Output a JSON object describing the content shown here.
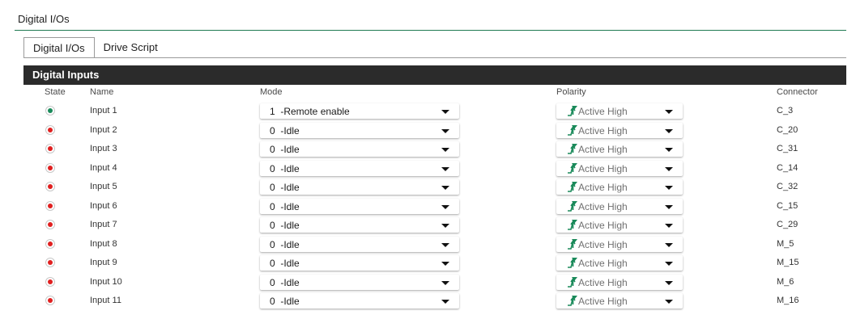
{
  "panel": {
    "title": "Digital I/Os"
  },
  "tabs": [
    {
      "label": "Digital I/Os",
      "active": true
    },
    {
      "label": "Drive Script",
      "active": false
    }
  ],
  "section": {
    "title": "Digital Inputs"
  },
  "columns": {
    "state": "State",
    "name": "Name",
    "mode": "Mode",
    "polarity": "Polarity",
    "connector": "Connector"
  },
  "colors": {
    "state_active": "#1a8a5a",
    "state_inactive": "#e02020",
    "polarity_icon": "#1a8a5a",
    "accent_rule": "#1f7a52"
  },
  "inputs": [
    {
      "state": "active",
      "name": "Input 1",
      "mode": "1  -Remote enable",
      "polarity": "Active High",
      "connector": "C_3"
    },
    {
      "state": "inactive",
      "name": "Input 2",
      "mode": "0  -Idle",
      "polarity": "Active High",
      "connector": "C_20"
    },
    {
      "state": "inactive",
      "name": "Input 3",
      "mode": "0  -Idle",
      "polarity": "Active High",
      "connector": "C_31"
    },
    {
      "state": "inactive",
      "name": "Input 4",
      "mode": "0  -Idle",
      "polarity": "Active High",
      "connector": "C_14"
    },
    {
      "state": "inactive",
      "name": "Input 5",
      "mode": "0  -Idle",
      "polarity": "Active High",
      "connector": "C_32"
    },
    {
      "state": "inactive",
      "name": "Input 6",
      "mode": "0  -Idle",
      "polarity": "Active High",
      "connector": "C_15"
    },
    {
      "state": "inactive",
      "name": "Input 7",
      "mode": "0  -Idle",
      "polarity": "Active High",
      "connector": "C_29"
    },
    {
      "state": "inactive",
      "name": "Input 8",
      "mode": "0  -Idle",
      "polarity": "Active High",
      "connector": "M_5"
    },
    {
      "state": "inactive",
      "name": "Input 9",
      "mode": "0  -Idle",
      "polarity": "Active High",
      "connector": "M_15"
    },
    {
      "state": "inactive",
      "name": "Input 10",
      "mode": "0  -Idle",
      "polarity": "Active High",
      "connector": "M_6"
    },
    {
      "state": "inactive",
      "name": "Input 11",
      "mode": "0  -Idle",
      "polarity": "Active High",
      "connector": "M_16"
    }
  ]
}
